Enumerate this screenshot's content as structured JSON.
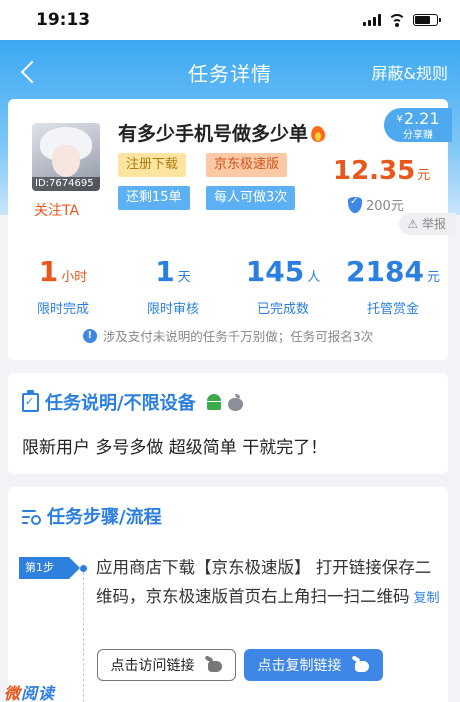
{
  "status_bar": {
    "time": "19:13"
  },
  "nav": {
    "title": "任务详情",
    "right_link": "屏蔽&规则"
  },
  "task": {
    "avatar_id": "ID:7674695",
    "follow_label": "关注TA",
    "title": "有多少手机号做多少单",
    "tags": [
      "注册下载",
      "京东极速版",
      "还剩15单",
      "每人可做3次"
    ],
    "share_badge": {
      "symbol": "¥",
      "amount": "2.21",
      "label": "分享赚"
    },
    "price": {
      "value": "12.35",
      "unit": "元"
    },
    "deposit": "200元",
    "report_label": "举报",
    "stats": [
      {
        "value": "1",
        "unit": "小时",
        "label": "限时完成"
      },
      {
        "value": "1",
        "unit": "天",
        "label": "限时审核"
      },
      {
        "value": "145",
        "unit": "人",
        "label": "已完成数"
      },
      {
        "value": "2184",
        "unit": "元",
        "label": "托管赏金"
      }
    ],
    "notice": "涉及支付未说明的任务千万别做；任务可报名3次"
  },
  "description": {
    "title": "任务说明/不限设备",
    "text": "限新用户 多号多做 超级简单 干就完了！"
  },
  "steps": {
    "title": "任务步骤/流程",
    "items": [
      {
        "badge": "第1步",
        "text": "应用商店下载【京东极速版】 打开链接保存二维码，京东极速版首页右上角扫一扫二维码",
        "copy_label": "复制",
        "visit_button": "点击访问链接",
        "copy_button": "点击复制链接"
      }
    ]
  },
  "watermark": {
    "part1": "微",
    "part2": "阅读"
  },
  "colors": {
    "accent_blue": "#2b7fe0",
    "accent_orange": "#e8571c",
    "header_blue": "#3aa8f2"
  }
}
